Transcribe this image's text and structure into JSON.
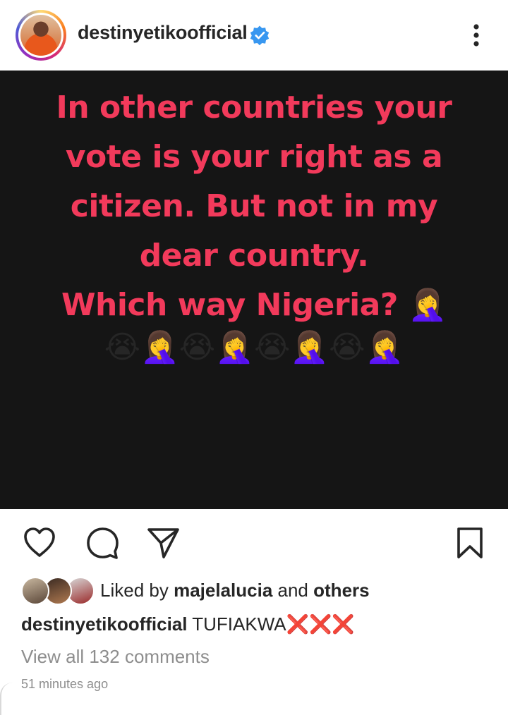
{
  "header": {
    "username": "destinyetikoofficial",
    "verified": true
  },
  "post": {
    "text_lines": [
      "In other countries your",
      "vote is your right as a",
      "citizen. But not in my",
      "dear country.",
      "Which way Nigeria?"
    ],
    "line5_emoji": "🤦‍♀️",
    "emoji_row": "😭🤦‍♀️😭🤦‍♀️😭🤦‍♀️😭🤦‍♀️",
    "background_color": "#151515",
    "text_color": "#f23a5b"
  },
  "actions": {
    "like_icon": "heart-icon",
    "comment_icon": "comment-icon",
    "share_icon": "send-icon",
    "save_icon": "bookmark-icon"
  },
  "likes": {
    "prefix": "Liked by",
    "user": "majelalucia",
    "conjunction": "and",
    "others": "others"
  },
  "caption": {
    "user": "destinyetikoofficial",
    "text": "TUFIAKWA",
    "marks": "❌❌❌"
  },
  "comments": {
    "view_all": "View all 132 comments"
  },
  "timestamp": "51 minutes ago"
}
